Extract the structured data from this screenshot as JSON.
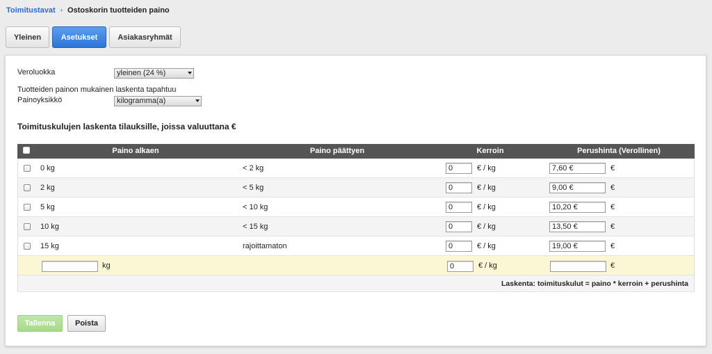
{
  "breadcrumb": {
    "link": "Toimitustavat",
    "separator": "+",
    "current": "Ostoskorin tuotteiden paino"
  },
  "tabs": [
    {
      "label": "Yleinen",
      "active": false
    },
    {
      "label": "Asetukset",
      "active": true
    },
    {
      "label": "Asiakasryhmät",
      "active": false
    }
  ],
  "settings": {
    "tax_label": "Veroluokka",
    "tax_value": "yleinen (24 %)",
    "calc_info": "Tuotteiden painon mukainen laskenta tapahtuu",
    "unit_label": "Painoyksikkö",
    "unit_value": "kilogramma(a)"
  },
  "section_title": "Toimituskulujen laskenta tilauksille, joissa valuuttana €",
  "table": {
    "columns": [
      "Paino alkaen",
      "Paino päättyen",
      "Kerroin",
      "Perushinta (Verollinen)"
    ],
    "rows": [
      {
        "from": "0 kg",
        "to": "< 2 kg",
        "multiplier": "0",
        "mult_unit": "€ / kg",
        "price": "7,60 €",
        "price_unit": "€"
      },
      {
        "from": "2 kg",
        "to": "< 5 kg",
        "multiplier": "0",
        "mult_unit": "€ / kg",
        "price": "9,00 €",
        "price_unit": "€"
      },
      {
        "from": "5 kg",
        "to": "< 10 kg",
        "multiplier": "0",
        "mult_unit": "€ / kg",
        "price": "10,20 €",
        "price_unit": "€"
      },
      {
        "from": "10 kg",
        "to": "< 15 kg",
        "multiplier": "0",
        "mult_unit": "€ / kg",
        "price": "13,50 €",
        "price_unit": "€"
      },
      {
        "from": "15 kg",
        "to": "rajoittamaton",
        "multiplier": "0",
        "mult_unit": "€ / kg",
        "price": "19,00 €",
        "price_unit": "€"
      }
    ],
    "new_row": {
      "from_value": "",
      "from_unit": "kg",
      "multiplier": "0",
      "mult_unit": "€ / kg",
      "price": "",
      "price_unit": "€"
    },
    "footer": "Laskenta: toimituskulut = paino * kerroin + perushinta"
  },
  "buttons": {
    "save": "Tallenna",
    "cancel": "Poista"
  },
  "colors": {
    "link": "#2a6bc9",
    "active_tab": "#2d74d8",
    "header_bg": "#555555",
    "new_row_bg": "#fbf6d3",
    "save_button": "#a6d98a"
  }
}
